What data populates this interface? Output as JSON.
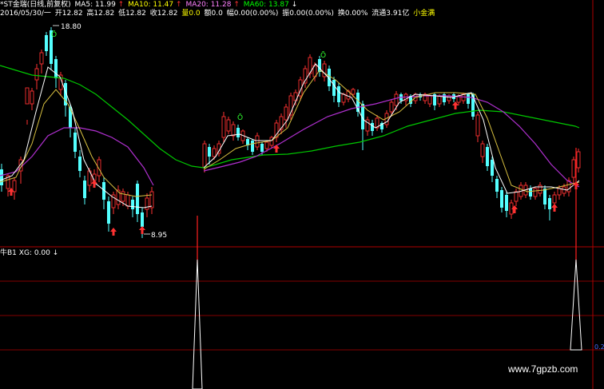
{
  "header": {
    "title": "*ST金瑞(日线,前复权)",
    "ma5_label": "MA5: 11.99",
    "ma10_label": "MA10: 11.47",
    "ma20_label": "MA20: 11.28",
    "ma60_label": "MA60: 13.87",
    "arrow_down": "↓",
    "arrow_up": "↑",
    "arrow_up2": "↑"
  },
  "quote": {
    "date": "2016/05/30/一",
    "open": "开12.82",
    "high": "高12.82",
    "low": "低12.82",
    "close": "收12.82",
    "volume": "量0.0",
    "amount": "额0.0",
    "change": "幅0.00(0.00%)",
    "amplitude": "振0.00(0.00%)",
    "turnover": "换0.00%",
    "float_cap": "流通3.91亿",
    "badge": "小金满"
  },
  "price_labels": {
    "high": "18.80",
    "low": "8.95"
  },
  "indicator": {
    "name": "牛B1",
    "label": "XG: 0.00",
    "arrow": "↓",
    "edge_value": "0.2"
  },
  "watermark": "www.7gpzb.com",
  "colors": {
    "background": "#000000",
    "up": "#ff3232",
    "down": "#54ffff",
    "ma5": "#ffffff",
    "ma10": "#ffff00",
    "ma20": "#ff80ff",
    "ma60": "#00ff00",
    "grid": "#b00000"
  }
}
